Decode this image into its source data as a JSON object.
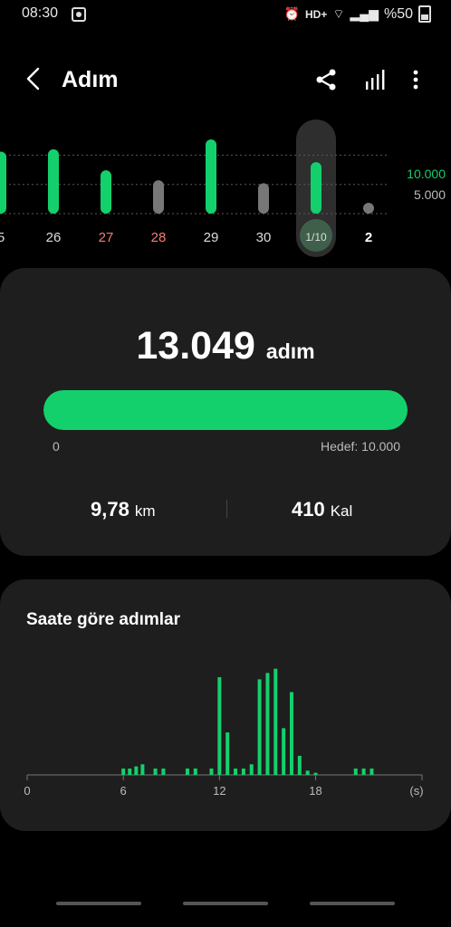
{
  "status_bar": {
    "time": "08:30",
    "network": "HD+",
    "battery": "%50"
  },
  "app_bar": {
    "title": "Adım"
  },
  "weekly": {
    "days": [
      {
        "label": "5",
        "steps": 10600,
        "color": "#14d06c",
        "label_color": "#dddddd"
      },
      {
        "label": "26",
        "steps": 11000,
        "color": "#14d06c",
        "label_color": "#dddddd"
      },
      {
        "label": "27",
        "steps": 7400,
        "color": "#14d06c",
        "label_color": "#f47c73"
      },
      {
        "label": "28",
        "steps": 5700,
        "color": "#777777",
        "label_color": "#f47c73"
      },
      {
        "label": "29",
        "steps": 12700,
        "color": "#14d06c",
        "label_color": "#dddddd"
      },
      {
        "label": "30",
        "steps": 5200,
        "color": "#777777",
        "label_color": "#dddddd"
      },
      {
        "label": "1/10",
        "steps": 8800,
        "color": "#14d06c",
        "label_color": "#dddddd",
        "selected": true
      },
      {
        "label": "2",
        "steps": 300,
        "color": "#777777",
        "label_color": "#ffffff"
      }
    ],
    "ref_lines": [
      {
        "label": "10.000",
        "value": 10000,
        "color": "#14d06c"
      },
      {
        "label": "5.000",
        "value": 5000,
        "color": "#bbbbbb"
      }
    ]
  },
  "summary": {
    "steps": "13.049",
    "steps_unit": "adım",
    "progress_min": "0",
    "goal_label": "Hedef: 10.000",
    "progress_fraction": 1.0,
    "distance": "9,78",
    "distance_unit": "km",
    "calories": "410",
    "calories_unit": "Kal"
  },
  "hourly": {
    "title": "Saate göre adımlar",
    "tick_labels": [
      "0",
      "6",
      "12",
      "18",
      "(s)"
    ],
    "chart_data": {
      "type": "bar",
      "x": [
        6.0,
        6.4,
        6.8,
        7.2,
        8.0,
        8.5,
        10.0,
        10.5,
        11.5,
        12.0,
        12.5,
        13.0,
        13.5,
        14.0,
        14.5,
        15.0,
        15.5,
        16.0,
        16.5,
        17.0,
        17.5,
        18.0,
        20.5,
        21.0,
        21.5
      ],
      "values": [
        300,
        300,
        400,
        500,
        300,
        300,
        300,
        300,
        300,
        4600,
        2000,
        300,
        300,
        500,
        4500,
        4800,
        5000,
        2200,
        3900,
        900,
        200,
        100,
        300,
        300,
        300
      ],
      "xlim": [
        0,
        23
      ],
      "ylim": [
        0,
        5200
      ]
    }
  },
  "colors": {
    "accent": "#14d06c",
    "card": "#1e1e1e",
    "background": "#000000"
  }
}
